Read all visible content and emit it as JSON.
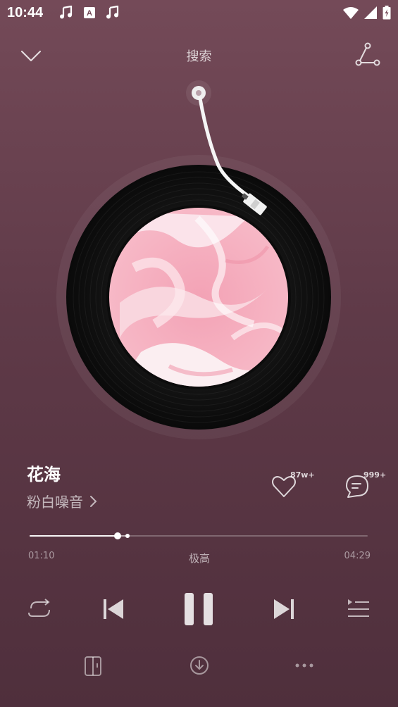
{
  "status_bar": {
    "time": "10:44"
  },
  "header": {
    "search_label": "搜索"
  },
  "song": {
    "title": "花海",
    "artist": "粉白噪音"
  },
  "actions": {
    "like_count": "87w+",
    "comment_count": "999+"
  },
  "progress": {
    "current_time": "01:10",
    "duration": "04:29",
    "quality": "极高",
    "played_fraction": 0.26,
    "buffered_fraction": 0.29
  },
  "colors": {
    "background_top": "#744a58",
    "background_bottom": "#4f2f3c",
    "album_pink": "#f4a7b9"
  },
  "icons": {
    "collapse": "chevron-down-icon",
    "share": "share-icon",
    "like": "heart-icon",
    "comment": "comment-icon",
    "repeat": "repeat-icon",
    "previous": "previous-icon",
    "pause": "pause-icon",
    "next": "next-icon",
    "playlist": "playlist-icon",
    "device": "device-icon",
    "download": "download-icon",
    "more": "more-icon"
  }
}
